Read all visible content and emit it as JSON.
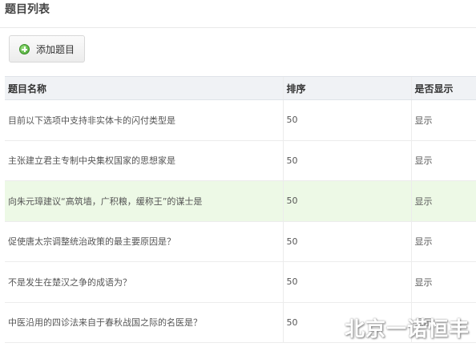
{
  "page": {
    "title": "题目列表"
  },
  "toolbar": {
    "add_label": "添加题目",
    "add_icon": "plus-circle-icon",
    "add_icon_color": "#4caf35"
  },
  "table": {
    "columns": [
      "题目名称",
      "排序",
      "是否显示"
    ],
    "rows": [
      {
        "name": "目前以下选项中支持非实体卡的闪付类型是",
        "sort": "50",
        "visible": "显示"
      },
      {
        "name": "主张建立君主专制中央集权国家的思想家是",
        "sort": "50",
        "visible": "显示"
      },
      {
        "name": "向朱元璋建议“高筑墙，广积粮，缓称王”的谋士是",
        "sort": "50",
        "visible": "显示"
      },
      {
        "name": "促使唐太宗调整统治政策的最主要原因是？",
        "sort": "50",
        "visible": "显示"
      },
      {
        "name": "不是发生在楚汉之争的成语为？",
        "sort": "50",
        "visible": "显示"
      },
      {
        "name": "中医沿用的四诊法来自于春秋战国之际的名医是？",
        "sort": "50",
        "visible": "显示"
      }
    ],
    "highlight_color": "#edf9e6"
  },
  "watermark": {
    "text": "北京一诺恒丰"
  }
}
